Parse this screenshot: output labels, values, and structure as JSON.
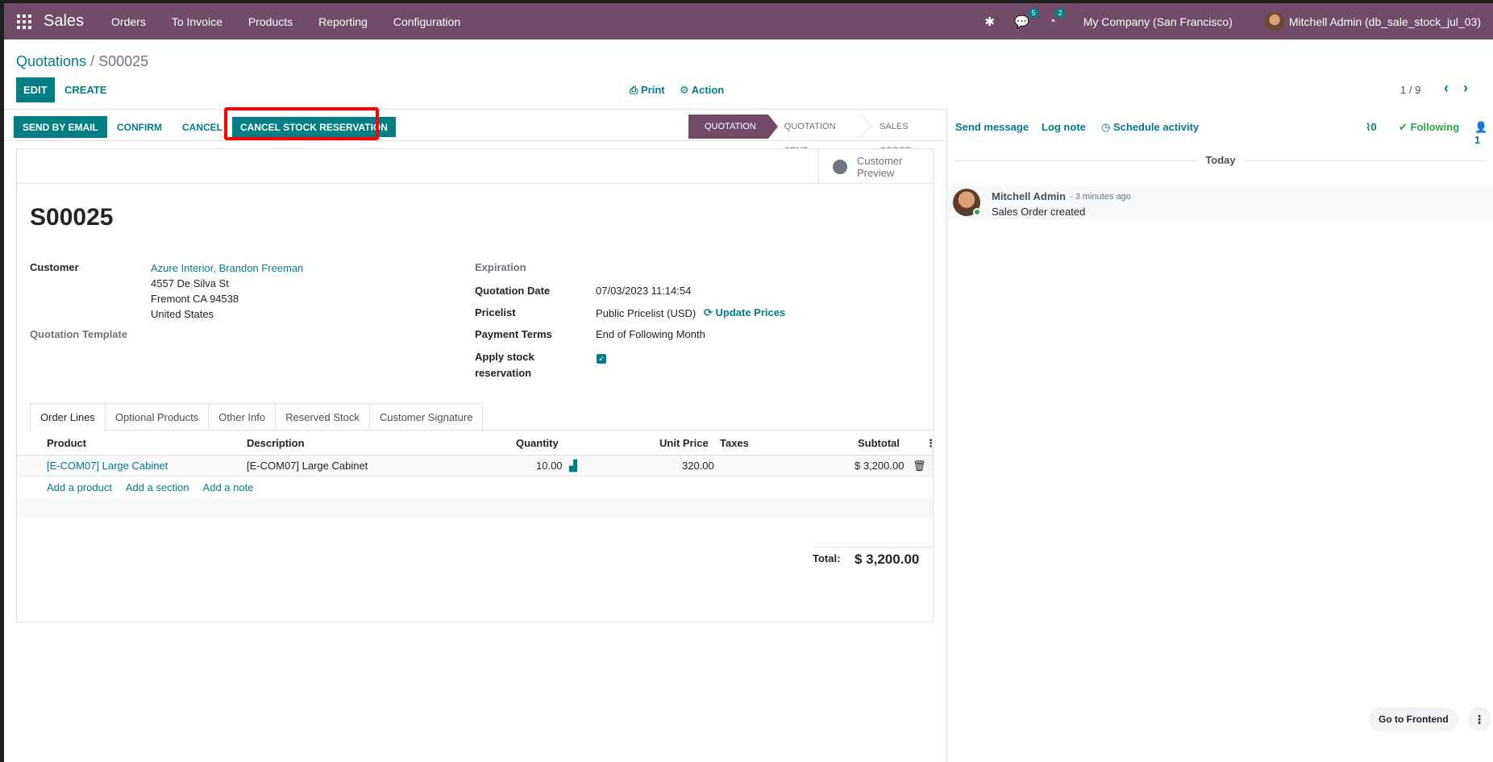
{
  "navbar": {
    "app": "Sales",
    "menu": [
      "Orders",
      "To Invoice",
      "Products",
      "Reporting",
      "Configuration"
    ],
    "messages_count": "5",
    "activities_count": "2",
    "company": "My Company (San Francisco)",
    "user": "Mitchell Admin (db_sale_stock_jul_03)"
  },
  "breadcrumb": {
    "parent": "Quotations",
    "separator": "/",
    "current": "S00025"
  },
  "toolbar": {
    "edit": "Edit",
    "create": "Create",
    "print": "Print",
    "action": "Action",
    "pager": "1 / 9"
  },
  "statusbar": {
    "send_email": "Send by Email",
    "confirm": "Confirm",
    "cancel": "Cancel",
    "cancel_stock": "Cancel Stock Reservation",
    "stages": [
      "Quotation",
      "Quotation Sent",
      "Sales Order"
    ],
    "active_stage": "Quotation"
  },
  "form": {
    "customer_preview": "Customer Preview",
    "name": "S00025",
    "customer_label": "Customer",
    "customer_name": "Azure Interior, Brandon Freeman",
    "address_line1": "4557 De Silva St",
    "address_line2": "Fremont CA 94538",
    "address_line3": "United States",
    "template_label": "Quotation Template",
    "expiration_label": "Expiration",
    "quotation_date_label": "Quotation Date",
    "quotation_date": "07/03/2023 11:14:54",
    "pricelist_label": "Pricelist",
    "pricelist": "Public Pricelist (USD)",
    "update_prices": "Update Prices",
    "payment_terms_label": "Payment Terms",
    "payment_terms": "End of Following Month",
    "apply_stock_label_1": "Apply stock",
    "apply_stock_label_2": "reservation",
    "apply_stock_checked": true
  },
  "tabs": [
    "Order Lines",
    "Optional Products",
    "Other Info",
    "Reserved Stock",
    "Customer Signature"
  ],
  "order_lines": {
    "columns": [
      "Product",
      "Description",
      "Quantity",
      "Unit Price",
      "Taxes",
      "Subtotal"
    ],
    "rows": [
      {
        "product": "[E-COM07] Large Cabinet",
        "description": "[E-COM07] Large Cabinet",
        "quantity": "10.00",
        "unit_price": "320.00",
        "taxes": "",
        "subtotal": "$ 3,200.00"
      }
    ],
    "add_product": "Add a product",
    "add_section": "Add a section",
    "add_note": "Add a note",
    "total_label": "Total:",
    "total_value": "$ 3,200.00"
  },
  "chatter": {
    "send_message": "Send message",
    "log_note": "Log note",
    "schedule_activity": "Schedule activity",
    "attachments": "0",
    "following": "Following",
    "followers": "1",
    "today": "Today",
    "author": "Mitchell Admin",
    "time": "- 3 minutes ago",
    "body": "Sales Order created"
  },
  "floating": {
    "go_to_frontend": "Go to Frontend"
  },
  "colors": {
    "brand": "#714b67",
    "accent": "#017e84",
    "highlight": "#ff0000"
  }
}
